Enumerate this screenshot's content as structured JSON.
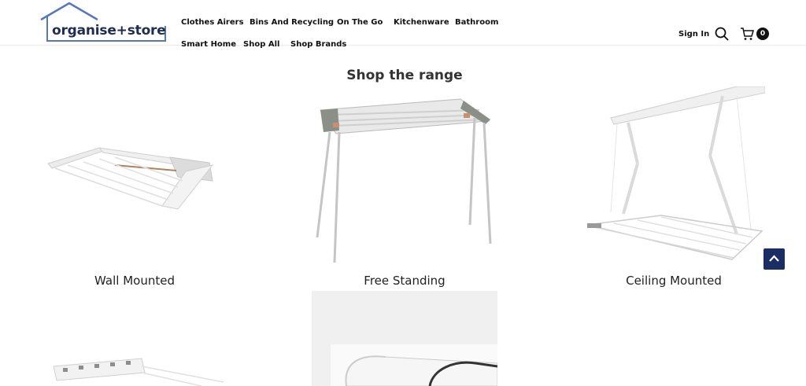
{
  "header": {
    "logo_text": "organise+store",
    "nav": [
      {
        "label": "Clothes Airers"
      },
      {
        "label": "Bins And Recycling"
      },
      {
        "label": "On The Go"
      },
      {
        "label": "Kitchenware"
      },
      {
        "label": "Bathroom"
      },
      {
        "label": "Smart Home"
      },
      {
        "label": "Shop All"
      },
      {
        "label": "Shop Brands"
      }
    ],
    "sign_in": "Sign In",
    "cart_count": "0"
  },
  "main": {
    "section_title": "Shop the range",
    "categories": [
      {
        "label": "Wall Mounted"
      },
      {
        "label": "Free Standing"
      },
      {
        "label": "Ceiling Mounted"
      }
    ]
  },
  "icons": {
    "logo": "house-outline-icon",
    "search": "search-icon",
    "cart": "cart-icon",
    "back_to_top": "chevron-up-icon"
  },
  "colors": {
    "brand_navy": "#1f2d4f",
    "logo_blue": "#5677b8",
    "back_to_top_bg": "#1b2e63"
  }
}
